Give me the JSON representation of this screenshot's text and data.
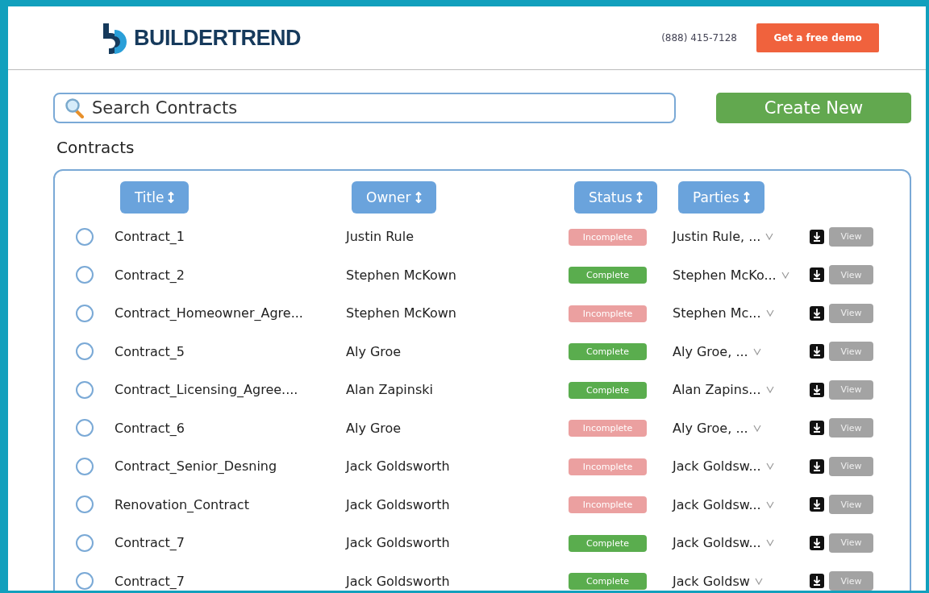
{
  "header": {
    "brand": "BUILDERTREND",
    "phone": "(888) 415-7128",
    "demo_button": "Get a free demo"
  },
  "search": {
    "placeholder": "Search Contracts"
  },
  "create_button": "Create New",
  "section_title": "Contracts",
  "table": {
    "columns": [
      "Title",
      "Owner",
      "Status",
      "Parties"
    ],
    "rows": [
      {
        "selected": false,
        "title": "Contract_1",
        "owner": "Justin Rule",
        "status": "Incomplete",
        "complete": false,
        "parties": "Justin Rule, ...",
        "view": "View"
      },
      {
        "selected": false,
        "title": "Contract_2",
        "owner": "Stephen McKown",
        "status": "Complete",
        "complete": true,
        "parties": "Stephen McKo...",
        "view": "View"
      },
      {
        "selected": false,
        "title": "Contract_Homeowner_Agre...",
        "owner": "Stephen McKown",
        "status": "Incomplete",
        "complete": false,
        "parties": "Stephen Mc...",
        "view": "View"
      },
      {
        "selected": false,
        "title": "Contract_5",
        "owner": "Aly Groe",
        "status": "Complete",
        "complete": true,
        "parties": "Aly Groe, ...",
        "view": "View"
      },
      {
        "selected": false,
        "title": "Contract_Licensing_Agree....",
        "owner": "Alan Zapinski",
        "status": "Complete",
        "complete": true,
        "parties": "Alan Zapins...",
        "view": "View"
      },
      {
        "selected": false,
        "title": "Contract_6",
        "owner": "Aly Groe",
        "status": "Incomplete",
        "complete": false,
        "parties": "Aly Groe, ...",
        "view": "View"
      },
      {
        "selected": false,
        "title": "Contract_Senior_Desning",
        "owner": "Jack Goldsworth",
        "status": "Incomplete",
        "complete": false,
        "parties": "Jack Goldsw...",
        "view": "View"
      },
      {
        "selected": false,
        "title": "Renovation_Contract",
        "owner": "Jack Goldsworth",
        "status": "Incomplete",
        "complete": false,
        "parties": "Jack Goldsw...",
        "view": "View"
      },
      {
        "selected": false,
        "title": "Contract_7",
        "owner": "Jack Goldsworth",
        "status": "Complete",
        "complete": true,
        "parties": "Jack Goldsw...",
        "view": "View"
      },
      {
        "selected": false,
        "title": "Contract_7",
        "owner": "Jack Goldsworth",
        "status": "Complete",
        "complete": true,
        "parties": "Jack Goldsw",
        "view": "View"
      }
    ]
  }
}
